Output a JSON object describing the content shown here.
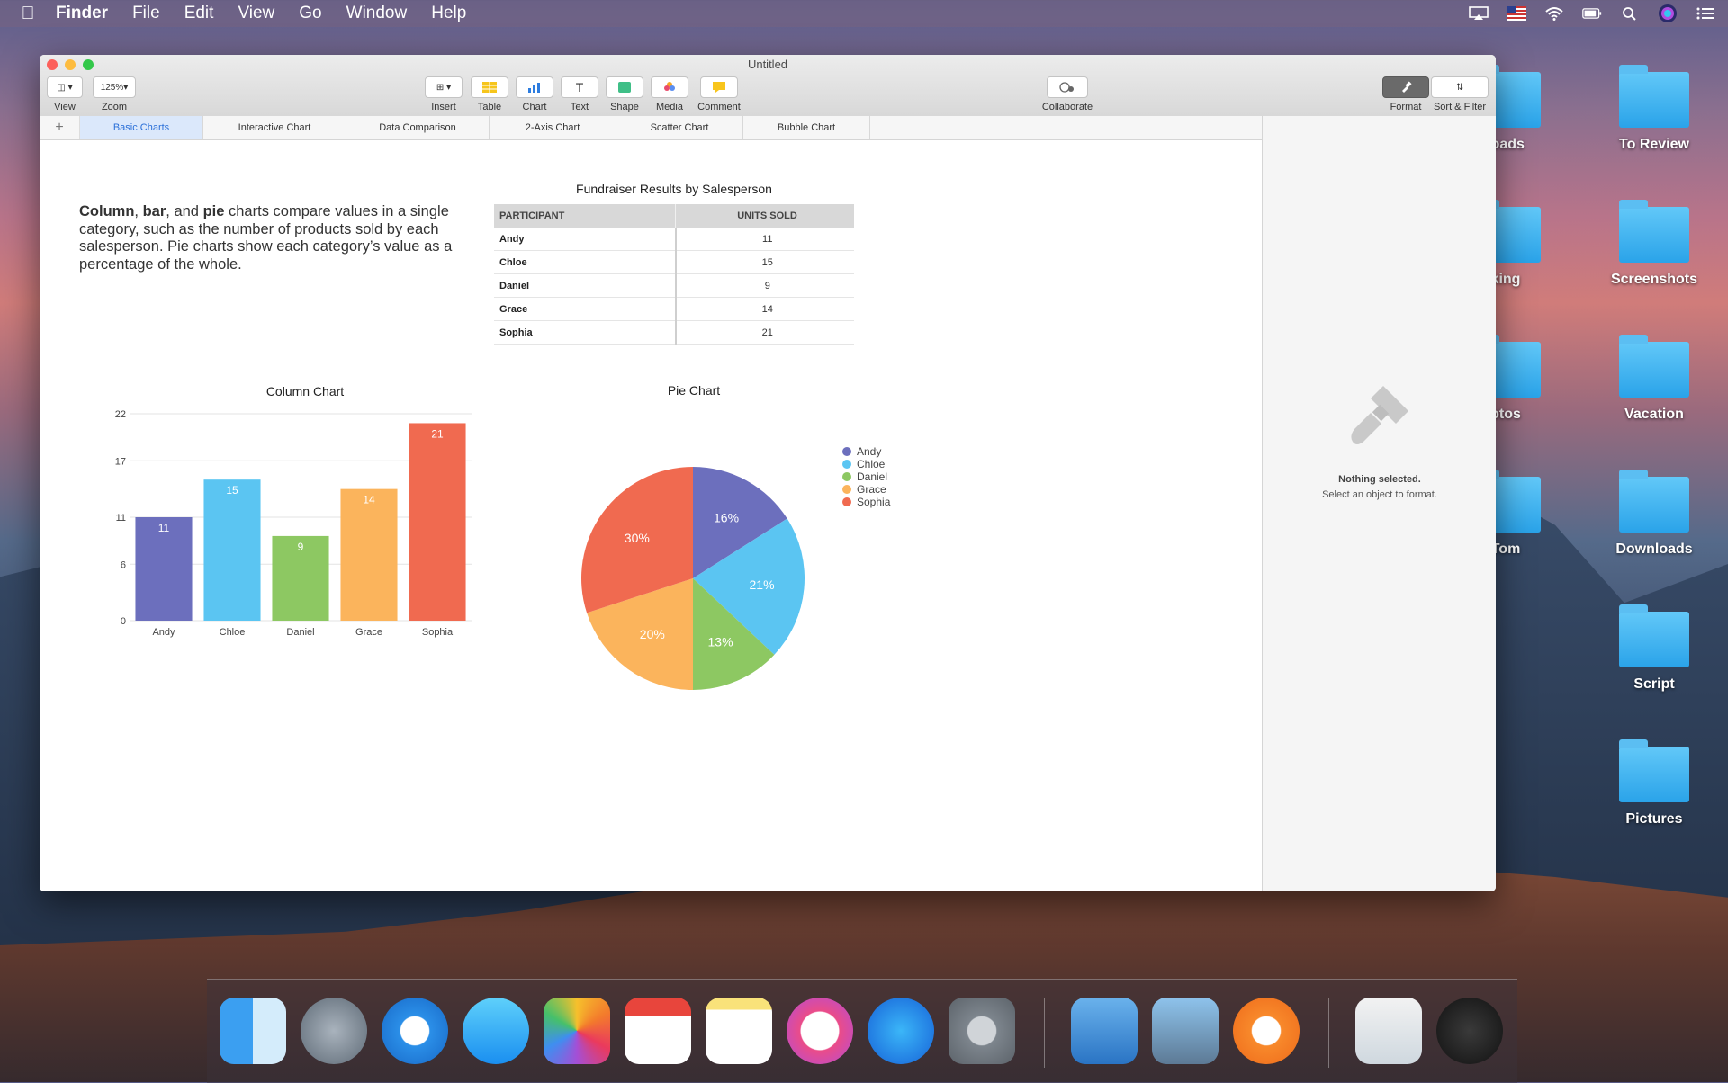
{
  "menubar": {
    "items": [
      "Finder",
      "File",
      "Edit",
      "View",
      "Go",
      "Window",
      "Help"
    ]
  },
  "desktop": {
    "folders": [
      "loads",
      "To Review",
      "king",
      "Screenshots",
      "otos",
      "Vacation",
      "Tom",
      "Downloads",
      "Script",
      "Pictures"
    ]
  },
  "window": {
    "title": "Untitled",
    "toolbar": {
      "view_label": "View",
      "zoom_label": "Zoom",
      "zoom_value": "125%",
      "insert_label": "Insert",
      "table_label": "Table",
      "chart_label": "Chart",
      "text_label": "Text",
      "shape_label": "Shape",
      "media_label": "Media",
      "comment_label": "Comment",
      "collaborate_label": "Collaborate",
      "format_label": "Format",
      "sort_filter_label": "Sort & Filter"
    },
    "tabs": [
      "Basic Charts",
      "Interactive Chart",
      "Data Comparison",
      "2-Axis Chart",
      "Scatter Chart",
      "Bubble Chart"
    ],
    "sidebar": {
      "heading": "Nothing selected.",
      "hint": "Select an object to format."
    }
  },
  "content": {
    "desc_b1": "Column",
    "desc_t1": ", ",
    "desc_b2": "bar",
    "desc_t2": ", and ",
    "desc_b3": "pie",
    "desc_t3": " charts compare values in a single category, such as the number of products sold by each salesperson. Pie charts show each category’s value as a percentage of the whole.",
    "table": {
      "title": "Fundraiser Results by Salesperson",
      "headers": [
        "PARTICIPANT",
        "UNITS SOLD"
      ],
      "rows": [
        [
          "Andy",
          "11"
        ],
        [
          "Chloe",
          "15"
        ],
        [
          "Daniel",
          "9"
        ],
        [
          "Grace",
          "14"
        ],
        [
          "Sophia",
          "21"
        ]
      ]
    }
  },
  "chart_data": [
    {
      "type": "bar",
      "title": "Column Chart",
      "categories": [
        "Andy",
        "Chloe",
        "Daniel",
        "Grace",
        "Sophia"
      ],
      "values": [
        11,
        15,
        9,
        14,
        21
      ],
      "ylim": [
        0,
        22
      ],
      "yticks": [
        0,
        6,
        11,
        17,
        22
      ],
      "colors": [
        "#6c6fbd",
        "#5bc5f2",
        "#8dc862",
        "#fbb45c",
        "#f06a50"
      ],
      "grid": true
    },
    {
      "type": "pie",
      "title": "Pie Chart",
      "categories": [
        "Andy",
        "Chloe",
        "Daniel",
        "Grace",
        "Sophia"
      ],
      "values": [
        16,
        21,
        13,
        20,
        30
      ],
      "labels": [
        "16%",
        "21%",
        "13%",
        "20%",
        "30%"
      ],
      "colors": [
        "#6c6fbd",
        "#5bc5f2",
        "#8dc862",
        "#fbb45c",
        "#f06a50"
      ],
      "legend": "right"
    }
  ]
}
